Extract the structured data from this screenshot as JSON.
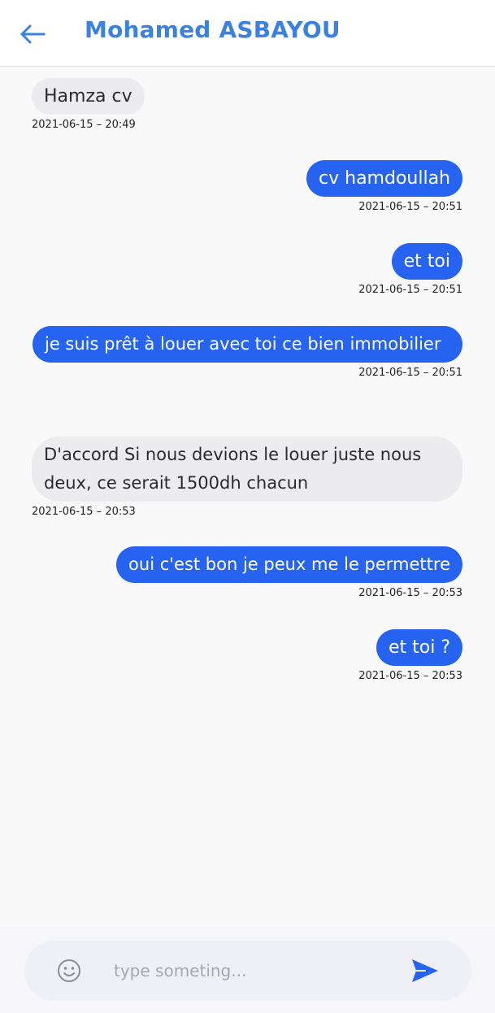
{
  "header": {
    "title": "Mohamed ASBAYOU",
    "back_icon": "arrow-left-icon",
    "accent": "#3b82e0"
  },
  "colors": {
    "outgoing_bubble": "#2563f0",
    "incoming_bubble": "#ececee"
  },
  "messages": [
    {
      "direction": "in",
      "text": "Hamza cv",
      "time": "2021-06-15 – 20:49"
    },
    {
      "direction": "out",
      "text": "cv hamdoullah",
      "time": "2021-06-15 – 20:51"
    },
    {
      "direction": "out",
      "text": "et toi",
      "time": "2021-06-15 – 20:51"
    },
    {
      "direction": "out",
      "text": "je suis prêt à louer avec toi ce bien immobilier",
      "time": "2021-06-15 – 20:51"
    },
    {
      "direction": "in",
      "text": "D'accord Si nous devions le louer juste nous deux, ce serait 1500dh chacun",
      "time": "2021-06-15 – 20:53"
    },
    {
      "direction": "out",
      "text": "oui c'est bon je peux me le permettre",
      "time": "2021-06-15 – 20:53"
    },
    {
      "direction": "out",
      "text": "et toi ?",
      "time": "2021-06-15 – 20:53"
    }
  ],
  "composer": {
    "placeholder": "type someting...",
    "value": "",
    "emoji_icon": "smiley-icon",
    "send_icon": "send-icon"
  }
}
